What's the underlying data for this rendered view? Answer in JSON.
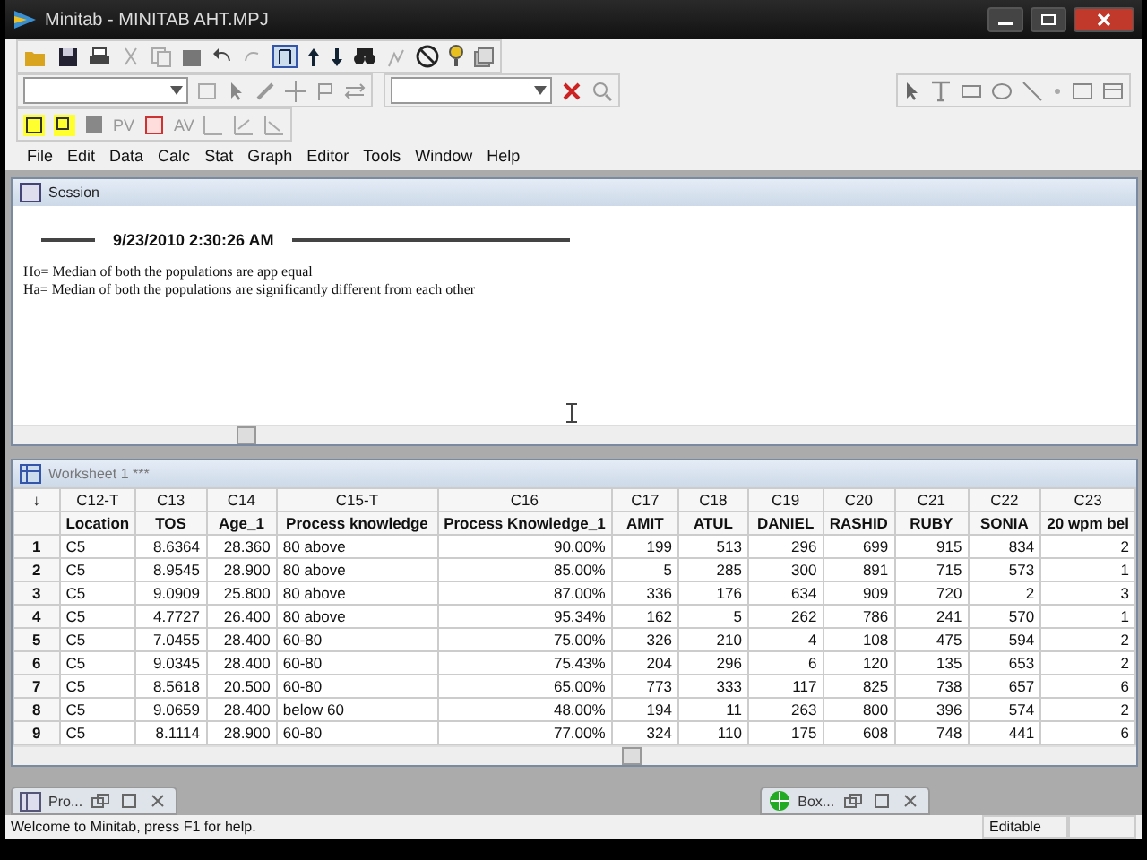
{
  "window": {
    "title": "Minitab - MINITAB AHT.MPJ"
  },
  "menu": [
    {
      "label": "File"
    },
    {
      "label": "Edit"
    },
    {
      "label": "Data"
    },
    {
      "label": "Calc"
    },
    {
      "label": "Stat"
    },
    {
      "label": "Graph"
    },
    {
      "label": "Editor"
    },
    {
      "label": "Tools"
    },
    {
      "label": "Window"
    },
    {
      "label": "Help"
    }
  ],
  "toolbar_labels": [
    "PV",
    "AV"
  ],
  "session": {
    "title": "Session",
    "timestamp": "9/23/2010 2:30:26 AM",
    "lines": [
      "Ho= Median of both the populations are app equal",
      "Ha= Median of both the populations are significantly different from each other"
    ]
  },
  "worksheet": {
    "title": "Worksheet 1 ***",
    "corner": "↓",
    "columns": [
      {
        "id": "C12-T",
        "name": "Location",
        "kind": "text"
      },
      {
        "id": "C13",
        "name": "TOS",
        "kind": "numeric"
      },
      {
        "id": "C14",
        "name": "Age_1",
        "kind": "numeric"
      },
      {
        "id": "C15-T",
        "name": "Process knowledge",
        "kind": "text"
      },
      {
        "id": "C16",
        "name": "Process Knowledge_1",
        "kind": "numeric"
      },
      {
        "id": "C17",
        "name": "AMIT",
        "kind": "numeric"
      },
      {
        "id": "C18",
        "name": "ATUL",
        "kind": "numeric"
      },
      {
        "id": "C19",
        "name": "DANIEL",
        "kind": "numeric"
      },
      {
        "id": "C20",
        "name": "RASHID",
        "kind": "numeric"
      },
      {
        "id": "C21",
        "name": "RUBY",
        "kind": "numeric"
      },
      {
        "id": "C22",
        "name": "SONIA",
        "kind": "numeric"
      },
      {
        "id": "C23",
        "name": "20 wpm bel",
        "kind": "numeric"
      }
    ],
    "rows": [
      {
        "n": "1",
        "cells": [
          "C5",
          "8.6364",
          "28.360",
          "80 above",
          "90.00%",
          "199",
          "513",
          "296",
          "699",
          "915",
          "834",
          "2"
        ]
      },
      {
        "n": "2",
        "cells": [
          "C5",
          "8.9545",
          "28.900",
          "80 above",
          "85.00%",
          "5",
          "285",
          "300",
          "891",
          "715",
          "573",
          "1"
        ]
      },
      {
        "n": "3",
        "cells": [
          "C5",
          "9.0909",
          "25.800",
          "80 above",
          "87.00%",
          "336",
          "176",
          "634",
          "909",
          "720",
          "2",
          "3"
        ]
      },
      {
        "n": "4",
        "cells": [
          "C5",
          "4.7727",
          "26.400",
          "80 above",
          "95.34%",
          "162",
          "5",
          "262",
          "786",
          "241",
          "570",
          "1"
        ]
      },
      {
        "n": "5",
        "cells": [
          "C5",
          "7.0455",
          "28.400",
          "60-80",
          "75.00%",
          "326",
          "210",
          "4",
          "108",
          "475",
          "594",
          "2"
        ]
      },
      {
        "n": "6",
        "cells": [
          "C5",
          "9.0345",
          "28.400",
          "60-80",
          "75.43%",
          "204",
          "296",
          "6",
          "120",
          "135",
          "653",
          "2"
        ]
      },
      {
        "n": "7",
        "cells": [
          "C5",
          "8.5618",
          "20.500",
          "60-80",
          "65.00%",
          "773",
          "333",
          "117",
          "825",
          "738",
          "657",
          "6"
        ]
      },
      {
        "n": "8",
        "cells": [
          "C5",
          "9.0659",
          "28.400",
          "below 60",
          "48.00%",
          "194",
          "11",
          "263",
          "800",
          "396",
          "574",
          "2"
        ]
      },
      {
        "n": "9",
        "cells": [
          "C5",
          "8.1114",
          "28.900",
          "60-80",
          "77.00%",
          "324",
          "110",
          "175",
          "608",
          "748",
          "441",
          "6"
        ]
      }
    ]
  },
  "minimized": [
    {
      "title": "Pro...",
      "kind": "project"
    },
    {
      "title": "Box...",
      "kind": "graph"
    }
  ],
  "status_bar": {
    "message": "Welcome to Minitab, press F1 for help.",
    "mode": "Editable"
  }
}
